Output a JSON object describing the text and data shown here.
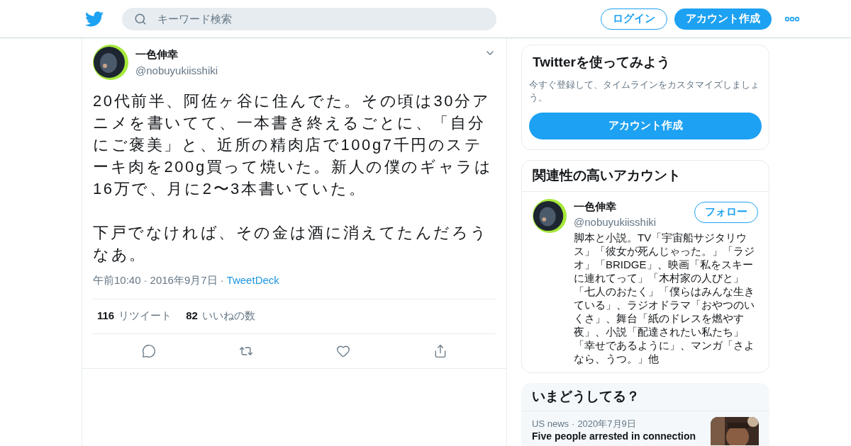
{
  "header": {
    "search": {
      "placeholder": "キーワード検索"
    },
    "login": "ログイン",
    "signup": "アカウント作成"
  },
  "tweet": {
    "name": "一色伸幸",
    "handle": "@nobuyukiisshiki",
    "paragraphs": [
      "20代前半、阿佐ヶ谷に住んでた。その頃は30分アニメを書いてて、一本書き終えるごとに、「自分にご褒美」と、近所の精肉店で100g7千円のステーキ肉を200g買って焼いた。新人の僕のギャラは16万で、月に2〜3本書いていた。",
      "下戸でなければ、その金は酒に消えてたんだろうなあ。"
    ],
    "time": "午前10:40",
    "date": "2016年9月7日",
    "source": "TweetDeck",
    "separator": "·",
    "stats": [
      {
        "count": "116",
        "label": "リツイート"
      },
      {
        "count": "82",
        "label": "いいねの数"
      }
    ],
    "actions": [
      {
        "kind": "reply"
      },
      {
        "kind": "retweet"
      },
      {
        "kind": "like"
      },
      {
        "kind": "share"
      }
    ]
  },
  "signup_card": {
    "title": "Twitterを使ってみよう",
    "text": "今すぐ登録して、タイムラインをカスタマイズしましょう。",
    "button": "アカウント作成"
  },
  "related": {
    "title": "関連性の高いアカウント",
    "name": "一色伸幸",
    "handle": "@nobuyukiisshiki",
    "follow": "フォロー",
    "bio": "脚本と小説。TV「宇宙船サジタリウス」「彼女が死んじゃった。」「ラジオ」「BRIDGE」、映画「私をスキーに連れてって」「木村家の人びと」「七人のおたく」「僕らはみんな生きている」、ラジオドラマ「おやつのいくさ」、舞台「紙のドレスを燃やす夜」、小説「配達されたい私たち」「幸せであるように」、マンガ「さよなら、うつ。」他"
  },
  "trends": {
    "title": "いまどうしてる？",
    "items": [
      {
        "category": "US news",
        "separator": "·",
        "date": "2020年7月9日",
        "headline": "Five people arrested in connection"
      }
    ]
  }
}
